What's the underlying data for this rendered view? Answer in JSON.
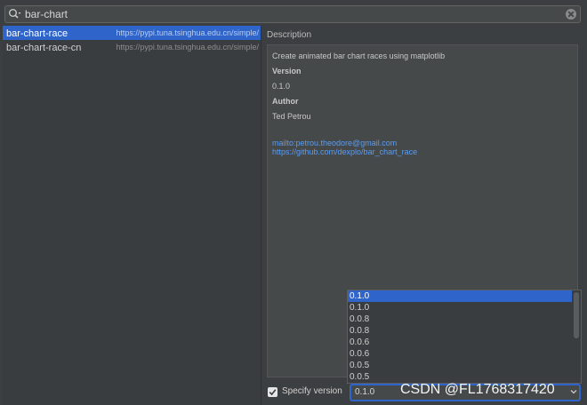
{
  "search": {
    "value": "bar-chart",
    "icon": "search-icon"
  },
  "packages": [
    {
      "name": "bar-chart-race",
      "repo": "https://pypi.tuna.tsinghua.edu.cn/simple/",
      "selected": true
    },
    {
      "name": "bar-chart-race-cn",
      "repo": "https://pypi.tuna.tsinghua.edu.cn/simple/",
      "selected": false
    }
  ],
  "description": {
    "title": "Description",
    "summary": "Create animated bar chart races using matplotlib",
    "version_label": "Version",
    "version_value": "0.1.0",
    "author_label": "Author",
    "author_value": "Ted Petrou",
    "email_link": "mailto:petrou.theodore@gmail.com",
    "repo_link": "https://github.com/dexplo/bar_chart_race"
  },
  "versions": [
    "0.1.0",
    "0.1.0",
    "0.0.8",
    "0.0.8",
    "0.0.6",
    "0.0.6",
    "0.0.5",
    "0.0.5"
  ],
  "specify": {
    "label": "Specify version",
    "checked": true,
    "selected_version": "0.1.0"
  },
  "watermark": "CSDN @FL1768317420",
  "colors": {
    "selection": "#2f65ca",
    "link": "#589df6"
  }
}
